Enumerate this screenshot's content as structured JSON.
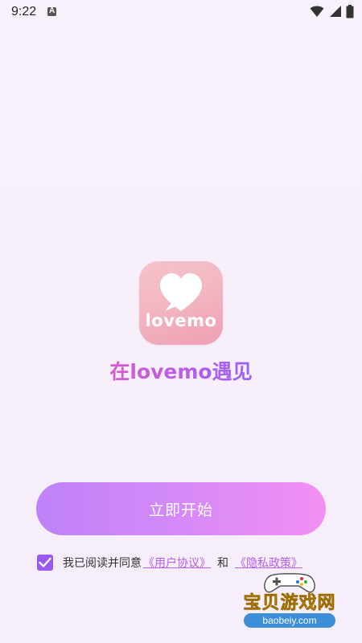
{
  "status_bar": {
    "time": "9:22",
    "notification_icon": "a-notification-icon",
    "wifi_icon": "wifi-icon",
    "signal_icon": "cell-signal-icon",
    "battery_icon": "battery-icon"
  },
  "logo": {
    "icon": "heart-chat-icon",
    "text": "lovemo"
  },
  "slogan": "在lovemo遇见",
  "start_button": {
    "label": "立即开始"
  },
  "agreement": {
    "checked": true,
    "prefix": "我已阅读并同意",
    "user_agreement": "《用户协议》",
    "and": "和",
    "privacy_policy": "《隐私政策》"
  },
  "watermark": {
    "title": "宝贝游戏网",
    "url": "baobeiy.com"
  },
  "colors": {
    "accent": "#b45df0",
    "button_start": "#bf82f8",
    "button_end": "#f38ff3",
    "logo_pink": "#f3b7c2"
  }
}
